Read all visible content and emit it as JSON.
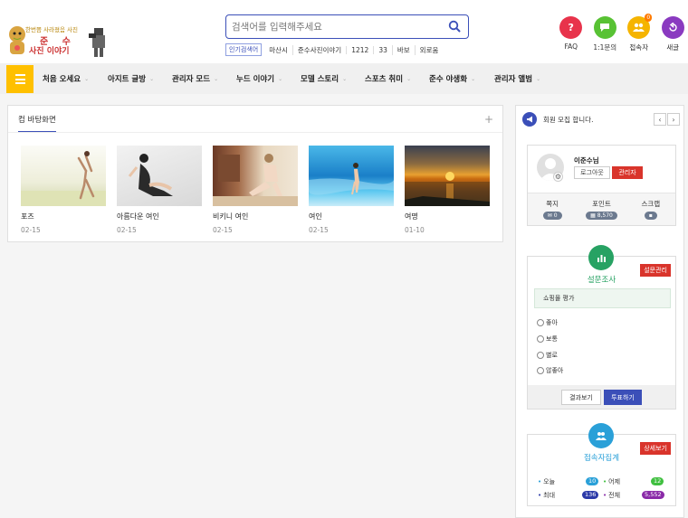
{
  "header": {
    "logo": {
      "line1": "한번쯤 사라졌음 사진",
      "line2": "준 수",
      "line3": "사진 이야기"
    },
    "search": {
      "placeholder": "검색어를 입력해주세요"
    },
    "popular": {
      "badge": "인기검색어",
      "keywords": [
        "마산시",
        "준수사진이야기",
        "1212",
        "33",
        "바보",
        "외로움"
      ]
    },
    "quick": [
      {
        "label": "FAQ",
        "icon": "question-icon",
        "color": "#e8334b"
      },
      {
        "label": "1:1문의",
        "icon": "chat-icon",
        "color": "#58c234"
      },
      {
        "label": "접속자",
        "icon": "users-icon",
        "color": "#f5b400",
        "count": "0"
      },
      {
        "label": "새글",
        "icon": "refresh-icon",
        "color": "#8a3ac0"
      }
    ]
  },
  "nav": {
    "items": [
      "처음 오세요",
      "아지트 글방",
      "관리자 모드",
      "누드 이야기",
      "모델 스토리",
      "스포츠 취미",
      "준수 야생화",
      "관리자 앨범"
    ]
  },
  "main": {
    "tab": "컴 바탕화면",
    "gallery": [
      {
        "title": "포즈",
        "date": "02-15"
      },
      {
        "title": "아름다운 여인",
        "date": "02-15"
      },
      {
        "title": "비키니 여인",
        "date": "02-15"
      },
      {
        "title": "여인",
        "date": "02-15"
      },
      {
        "title": "여명",
        "date": "01-10"
      }
    ]
  },
  "sidebar": {
    "notice": "회원 모집 합니다.",
    "member": {
      "name": "이준수님",
      "logout": "로그아웃",
      "admin": "관리자",
      "stats": [
        {
          "label": "쪽지",
          "value": "0",
          "icon": "mail-icon"
        },
        {
          "label": "포인트",
          "value": "8,570",
          "icon": "coin-icon"
        },
        {
          "label": "스크랩",
          "value": "",
          "icon": "pin-icon"
        }
      ]
    },
    "poll": {
      "title": "설문조사",
      "admin_btn": "설문관리",
      "question": "쇼핑몰 평가",
      "options": [
        "좋아",
        "보통",
        "별로",
        "않좋아"
      ],
      "result_btn": "결과보기",
      "vote_btn": "투표하기"
    },
    "visit": {
      "title": "접속자집계",
      "detail_btn": "상세보기",
      "rows": [
        {
          "label": "오늘",
          "value": "10",
          "color": "#2aa0d8"
        },
        {
          "label": "어제",
          "value": "12",
          "color": "#3fbf3f"
        },
        {
          "label": "최대",
          "value": "136",
          "color": "#2c3aa8"
        },
        {
          "label": "전체",
          "value": "5,552",
          "color": "#8a2aa8"
        }
      ]
    }
  }
}
